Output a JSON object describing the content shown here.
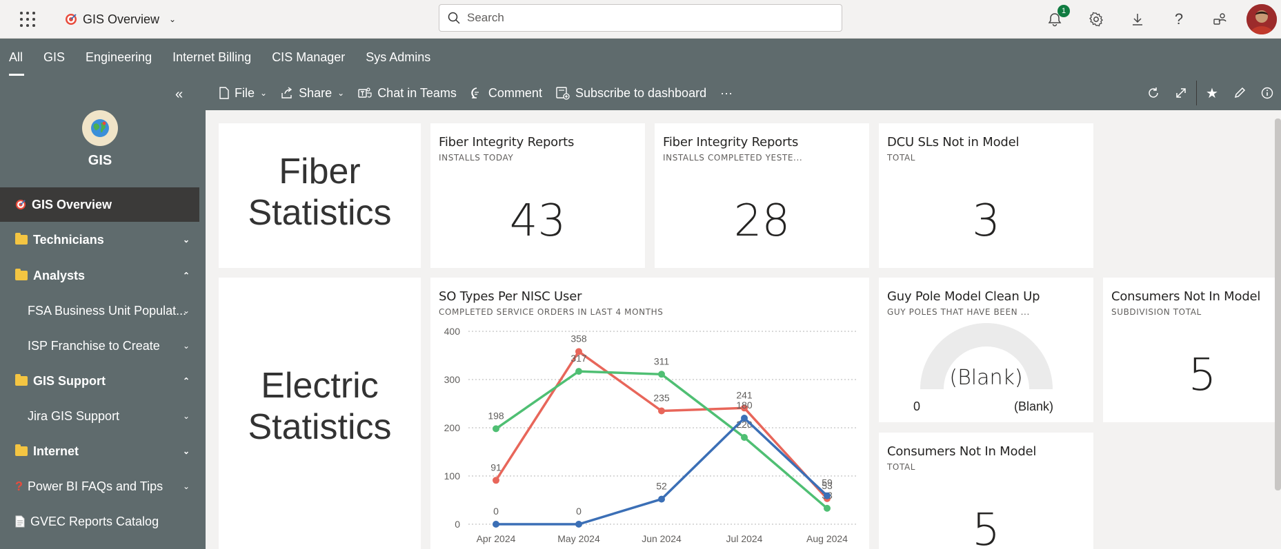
{
  "header": {
    "app_title": "GIS Overview",
    "search_placeholder": "Search",
    "notification_count": "1"
  },
  "nav_tabs": [
    {
      "label": "All",
      "active": true
    },
    {
      "label": "GIS"
    },
    {
      "label": "Engineering"
    },
    {
      "label": "Internet Billing"
    },
    {
      "label": "CIS Manager"
    },
    {
      "label": "Sys Admins"
    }
  ],
  "sidebar": {
    "workspace_name": "GIS",
    "items": [
      {
        "label": "GIS Overview",
        "icon": "target-icon",
        "active": true
      },
      {
        "label": "Technicians",
        "icon": "folder-icon",
        "chevron": "down"
      },
      {
        "label": "Analysts",
        "icon": "folder-icon",
        "chevron": "up"
      },
      {
        "label": "FSA Business Unit Populat...",
        "chevron": "down"
      },
      {
        "label": "ISP Franchise to Create",
        "chevron": "down"
      },
      {
        "label": "GIS Support",
        "icon": "folder-icon",
        "chevron": "up"
      },
      {
        "label": "Jira GIS Support",
        "chevron": "down"
      },
      {
        "label": "Internet",
        "icon": "folder-icon",
        "chevron": "down"
      },
      {
        "label": "Power BI FAQs and Tips",
        "icon": "question-icon",
        "chevron": "down"
      },
      {
        "label": "GVEC Reports Catalog",
        "icon": "document-icon"
      }
    ]
  },
  "toolbar": {
    "file": "File",
    "share": "Share",
    "chat": "Chat in Teams",
    "comment": "Comment",
    "subscribe": "Subscribe to dashboard",
    "more": "···"
  },
  "tiles": {
    "fiber_text": [
      "Fiber",
      "Statistics"
    ],
    "electric_text": [
      "Electric",
      "Statistics"
    ],
    "fiber_today": {
      "title": "Fiber Integrity Reports",
      "subtitle": "INSTALLS TODAY",
      "value": "43"
    },
    "fiber_yesterday": {
      "title": "Fiber Integrity Reports",
      "subtitle": "INSTALLS COMPLETED YESTE...",
      "value": "28"
    },
    "dcu": {
      "title": "DCU SLs Not in Model",
      "subtitle": "TOTAL",
      "value": "3"
    },
    "so_chart": {
      "title": "SO Types Per NISC User",
      "subtitle": "COMPLETED SERVICE ORDERS IN LAST 4 MONTHS"
    },
    "guy_pole": {
      "title": "Guy Pole Model Clean Up",
      "subtitle": "GUY POLES THAT HAVE BEEN ...",
      "gauge_value": "(Blank)",
      "gauge_min": "0",
      "gauge_max": "(Blank)"
    },
    "consumers_sub": {
      "title": "Consumers Not In Model",
      "subtitle": "SUBDIVISION TOTAL",
      "value": "5"
    },
    "consumers_total": {
      "title": "Consumers Not In Model",
      "subtitle": "TOTAL",
      "value": "5"
    }
  },
  "chart_data": {
    "type": "line",
    "categories": [
      "Apr 2024",
      "May 2024",
      "Jun 2024",
      "Jul 2024",
      "Aug 2024"
    ],
    "ylim": [
      0,
      400
    ],
    "yticks": [
      0,
      100,
      200,
      300,
      400
    ],
    "grid": true,
    "series": [
      {
        "color": "#e8665a",
        "values": [
          91,
          358,
          235,
          241,
          53
        ],
        "labels": [
          "91",
          "358",
          "235",
          "241",
          "53"
        ]
      },
      {
        "color": "#4fbf73",
        "values": [
          198,
          317,
          311,
          180,
          33
        ],
        "labels": [
          "198",
          "317",
          "311",
          "220",
          "33"
        ]
      },
      {
        "color": "#3b6fb6",
        "values": [
          0,
          0,
          52,
          220,
          59
        ],
        "labels": [
          "0",
          "0",
          "52",
          "180",
          "59"
        ]
      }
    ]
  },
  "colors": {
    "nav_bg": "#5f6b6d",
    "active_item_bg": "#3b3a39",
    "canvas_bg": "#f3f2f1"
  }
}
